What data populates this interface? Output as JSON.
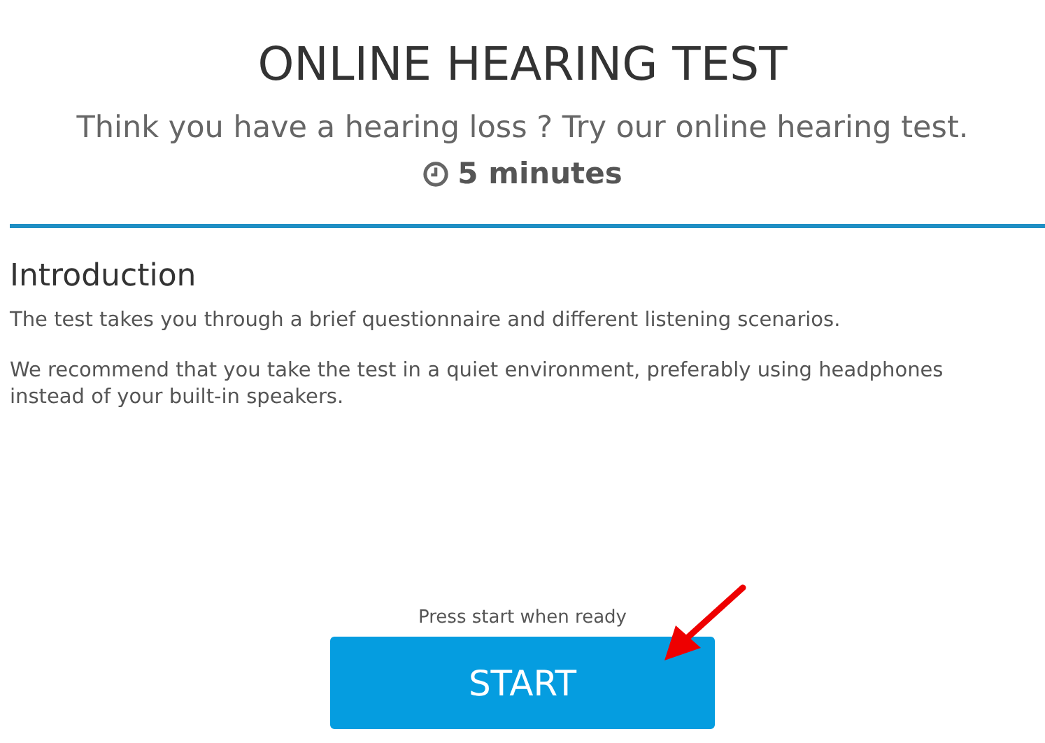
{
  "header": {
    "title": "ONLINE HEARING TEST",
    "subtitle": "Think you have a hearing loss ? Try our online hearing test.",
    "duration": "5 minutes"
  },
  "introduction": {
    "heading": "Introduction",
    "paragraphs": [
      "The test takes you through a brief questionnaire and different listening scenarios.",
      "We recommend that you take the test in a quiet environment, preferably using headphones instead of your built-in speakers."
    ]
  },
  "start": {
    "hint": "Press start when ready",
    "button": "START"
  }
}
